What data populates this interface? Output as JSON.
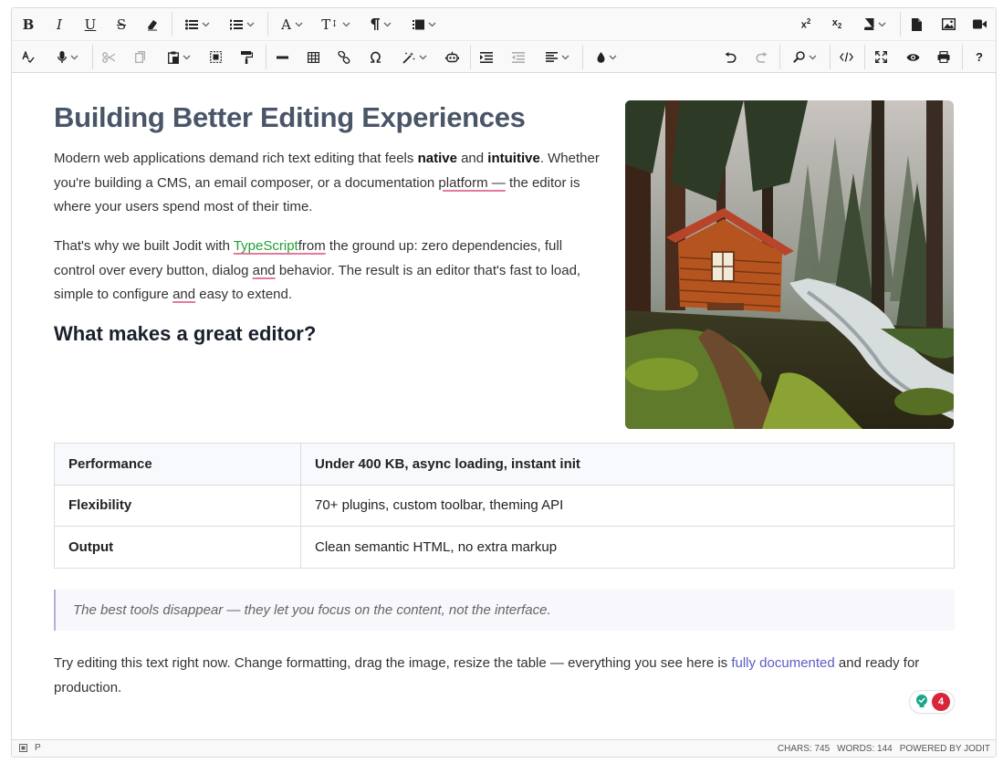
{
  "toolbar": {
    "row1": {
      "bold": "B",
      "italic": "I",
      "underline": "U",
      "strikethrough": "S",
      "font": "A",
      "font_size": "T",
      "superscript": "x",
      "superscript_mark": "2",
      "subscript": "x",
      "subscript_mark": "2"
    },
    "row2": {
      "help": "?"
    }
  },
  "content": {
    "title": "Building Better Editing Experiences",
    "p1": {
      "a": "Modern web applications demand rich text editing that feels ",
      "bold1": "native",
      "b": " and ",
      "bold2": "intuitive",
      "c": ". Whether you're building a CMS, an email composer, or a documentation ",
      "spell": "platform —",
      "d": " the editor is where your users spend most of their time."
    },
    "p2": {
      "a": "That's why we built Jodit with ",
      "link": "TypeScript",
      "spell1": "from",
      "b": " the ground up: zero dependencies, full control over every button, dialog ",
      "spell2": "and",
      "c": " behavior. The result is an editor that's fast to load, simple to configure ",
      "spell3": "and",
      "d": " easy to extend."
    },
    "subtitle": "What makes a great editor?",
    "table": [
      [
        "Performance",
        "Under 400 KB, async loading, instant init"
      ],
      [
        "Flexibility",
        "70+ plugins, custom toolbar, theming API"
      ],
      [
        "Output",
        "Clean semantic HTML, no extra markup"
      ]
    ],
    "quote": "The best tools disappear — they let you focus on the content, not the interface.",
    "p3": {
      "a": "Try editing this text right now. Change formatting, drag the image, resize the table — everything you see here is ",
      "link": "fully documented",
      "b": " and ready for production."
    },
    "badge_count": "4"
  },
  "status": {
    "path": "P",
    "chars": "CHARS: 745",
    "words": "WORDS: 144",
    "powered": "POWERED BY JODIT"
  },
  "colors": {
    "title": "#4a5568",
    "link_green": "#22a034",
    "link_blue": "#5a5cc4",
    "badge_red": "#d8253a",
    "spell_underline": "#e5799a"
  }
}
